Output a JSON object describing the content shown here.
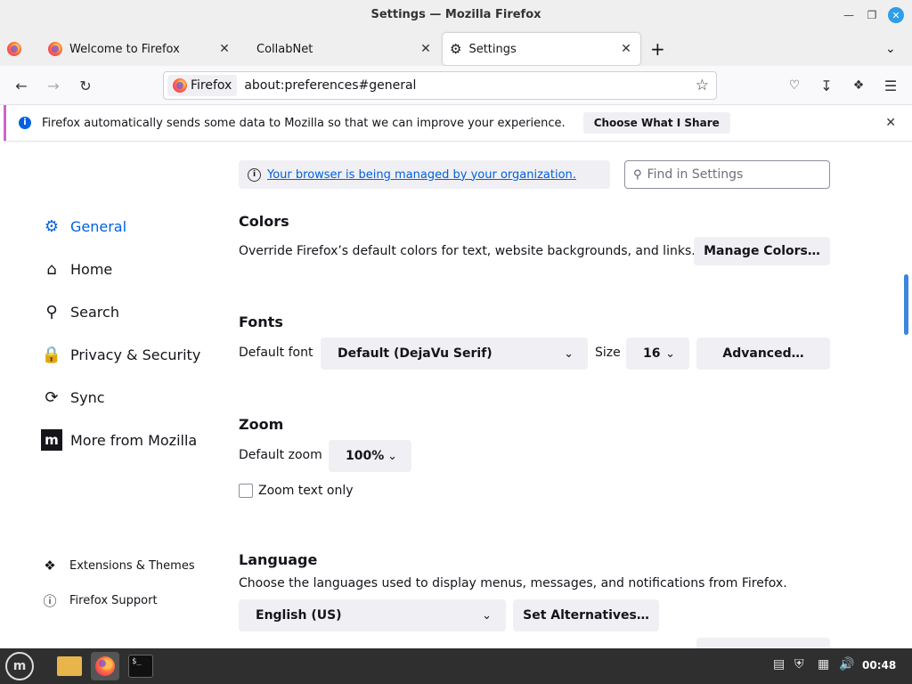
{
  "window": {
    "title": "Settings — Mozilla Firefox"
  },
  "tabs": [
    {
      "label": "Welcome to Firefox"
    },
    {
      "label": "CollabNet"
    },
    {
      "label": "Settings",
      "active": true
    }
  ],
  "navbar": {
    "identity_label": "Firefox",
    "url": "about:preferences#general"
  },
  "notification": {
    "text": "Firefox automatically sends some data to Mozilla so that we can improve your experience.",
    "button": "Choose What I Share"
  },
  "managed_link": "Your browser is being managed by your organization.",
  "search": {
    "placeholder": "Find in Settings"
  },
  "sidebar": {
    "items": [
      {
        "label": "General",
        "icon": "gear-icon",
        "selected": true
      },
      {
        "label": "Home",
        "icon": "home-icon"
      },
      {
        "label": "Search",
        "icon": "search-icon"
      },
      {
        "label": "Privacy & Security",
        "icon": "lock-icon"
      },
      {
        "label": "Sync",
        "icon": "sync-icon"
      },
      {
        "label": "More from Mozilla",
        "icon": "mozilla-icon"
      }
    ],
    "footer": [
      {
        "label": "Extensions & Themes",
        "icon": "puzzle-icon"
      },
      {
        "label": "Firefox Support",
        "icon": "help-icon"
      }
    ]
  },
  "colors": {
    "heading": "Colors",
    "description": "Override Firefox’s default colors for text, website backgrounds, and links.",
    "button": "Manage Colors…"
  },
  "fonts": {
    "heading": "Fonts",
    "default_font_label": "Default font",
    "default_font_value": "Default (DejaVu Serif)",
    "size_label": "Size",
    "size_value": "16",
    "advanced_button": "Advanced…"
  },
  "zoom": {
    "heading": "Zoom",
    "default_zoom_label": "Default zoom",
    "default_zoom_value": "100%",
    "zoom_text_only_label": "Zoom text only",
    "zoom_text_only_checked": false
  },
  "language": {
    "heading": "Language",
    "description": "Choose the languages used to display menus, messages, and notifications from Firefox.",
    "value": "English (US)",
    "alternatives_button": "Set Alternatives…"
  },
  "taskbar": {
    "clock": "00:48"
  },
  "colors_accent": {
    "link": "#0061e0",
    "scroll": "#3d86dd",
    "taskbar": "#2f2f2f"
  }
}
